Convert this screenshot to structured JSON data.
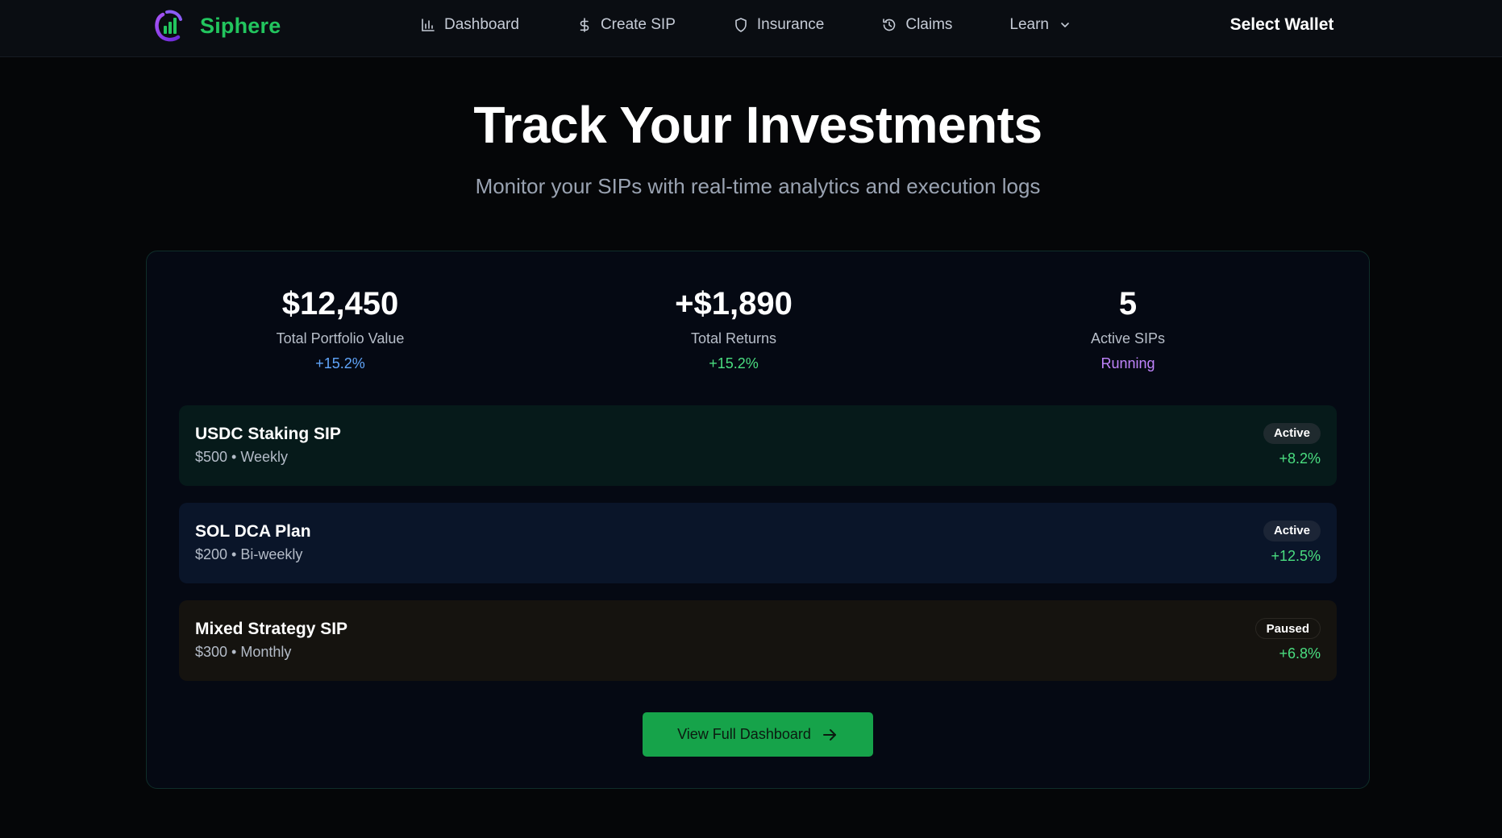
{
  "nav": {
    "brand": "Siphere",
    "links": [
      {
        "label": "Dashboard",
        "icon": "bar-chart-icon"
      },
      {
        "label": "Create SIP",
        "icon": "dollar-icon"
      },
      {
        "label": "Insurance",
        "icon": "shield-icon"
      },
      {
        "label": "Claims",
        "icon": "history-icon"
      },
      {
        "label": "Learn",
        "icon": "chevron-down-icon"
      }
    ],
    "wallet_label": "Select Wallet"
  },
  "hero": {
    "title": "Track Your Investments",
    "subtitle": "Monitor your SIPs with real-time analytics and execution logs"
  },
  "stats": [
    {
      "value": "$12,450",
      "label": "Total Portfolio Value",
      "change": "+15.2%",
      "change_color": "#60a5fa"
    },
    {
      "value": "+$1,890",
      "label": "Total Returns",
      "change": "+15.2%",
      "change_color": "#4ade80"
    },
    {
      "value": "5",
      "label": "Active SIPs",
      "change": "Running",
      "change_color": "#c084fc"
    }
  ],
  "sips": [
    {
      "name": "USDC Staking SIP",
      "meta": "$500 • Weekly",
      "status": "Active",
      "return": "+8.2%",
      "bg": "#061a1a",
      "badge_bg": "#1f2a2e"
    },
    {
      "name": "SOL DCA Plan",
      "meta": "$200 • Bi-weekly",
      "status": "Active",
      "return": "+12.5%",
      "bg": "#0a1529",
      "badge_bg": "#1c2536"
    },
    {
      "name": "Mixed Strategy SIP",
      "meta": "$300 • Monthly",
      "status": "Paused",
      "return": "+6.8%",
      "bg": "#15130f",
      "badge_bg": "#15130f"
    }
  ],
  "cta_label": "View Full Dashboard",
  "colors": {
    "brand": "#22c55e",
    "accent_green": "#16a34a",
    "background": "#050608"
  }
}
